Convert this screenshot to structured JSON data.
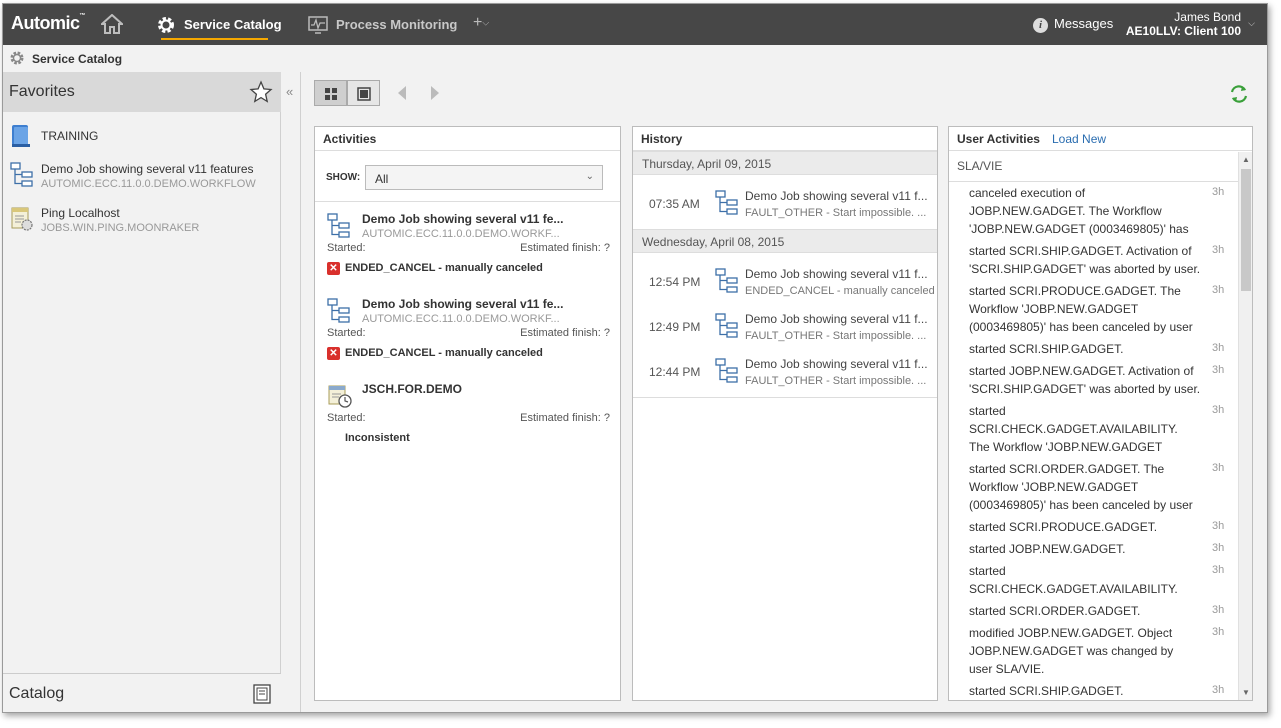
{
  "topbar": {
    "logo": "Automic",
    "tabs": [
      {
        "label": "Service Catalog",
        "active": true
      },
      {
        "label": "Process Monitoring",
        "active": false
      }
    ],
    "plus_label": "+",
    "messages_label": "Messages",
    "user_name": "James Bond",
    "user_client": "AE10LLV: Client 100",
    "accent_color": "#f5a800"
  },
  "breadcrumb": {
    "label": "Service Catalog"
  },
  "left": {
    "favorites_title": "Favorites",
    "favorites": [
      {
        "title": "TRAINING",
        "subtitle": "",
        "icon": "folder-icon"
      },
      {
        "title": "Demo Job showing several v11 features",
        "subtitle": "AUTOMIC.ECC.11.0.0.DEMO.WORKFLOW",
        "icon": "workflow-icon"
      },
      {
        "title": "Ping Localhost",
        "subtitle": "JOBS.WIN.PING.MOONRAKER",
        "icon": "job-icon"
      }
    ],
    "catalog_title": "Catalog"
  },
  "activities": {
    "title": "Activities",
    "show_label": "SHOW:",
    "show_value": "All",
    "items": [
      {
        "title": "Demo Job showing several v11 fe...",
        "subtitle": "AUTOMIC.ECC.11.0.0.DEMO.WORKF...",
        "started": "Started:",
        "estimated": "Estimated finish: ?",
        "status": "ENDED_CANCEL - manually canceled"
      },
      {
        "title": "Demo Job showing several v11 fe...",
        "subtitle": "AUTOMIC.ECC.11.0.0.DEMO.WORKF...",
        "started": "Started:",
        "estimated": "Estimated finish: ?",
        "status": "ENDED_CANCEL - manually canceled"
      },
      {
        "title": "JSCH.FOR.DEMO",
        "subtitle": "",
        "started": "Started:",
        "estimated": "Estimated finish: ?",
        "status": "Inconsistent"
      }
    ]
  },
  "history": {
    "title": "History",
    "days": [
      {
        "label": "Thursday, April 09, 2015",
        "rows": [
          {
            "time": "07:35 AM",
            "title": "Demo Job showing several v11 f...",
            "status": "FAULT_OTHER - Start impossible. ..."
          }
        ]
      },
      {
        "label": "Wednesday, April 08, 2015",
        "rows": [
          {
            "time": "12:54 PM",
            "title": "Demo Job showing several v11 f...",
            "status": "ENDED_CANCEL - manually canceled"
          },
          {
            "time": "12:49 PM",
            "title": "Demo Job showing several v11 f...",
            "status": "FAULT_OTHER - Start impossible. ..."
          },
          {
            "time": "12:44 PM",
            "title": "Demo Job showing several v11 f...",
            "status": "FAULT_OTHER - Start impossible. ..."
          }
        ]
      }
    ]
  },
  "user_activities": {
    "title": "User Activities",
    "load_new": "Load New",
    "user": "SLA/VIE",
    "items": [
      {
        "lines": [
          "canceled execution of",
          "JOBP.NEW.GADGET. The Workflow",
          "'JOBP.NEW.GADGET (0003469805)' has"
        ],
        "time": "3h"
      },
      {
        "lines": [
          "started SCRI.SHIP.GADGET. Activation of",
          "'SCRI.SHIP.GADGET' was aborted by user."
        ],
        "time": "3h"
      },
      {
        "lines": [
          "started SCRI.PRODUCE.GADGET. The",
          "Workflow 'JOBP.NEW.GADGET",
          "(0003469805)' has been canceled by user"
        ],
        "time": "3h"
      },
      {
        "lines": [
          "started SCRI.SHIP.GADGET."
        ],
        "time": "3h"
      },
      {
        "lines": [
          "started JOBP.NEW.GADGET. Activation of",
          "'SCRI.SHIP.GADGET' was aborted by user."
        ],
        "time": "3h"
      },
      {
        "lines": [
          "started",
          "SCRI.CHECK.GADGET.AVAILABILITY.",
          "The Workflow 'JOBP.NEW.GADGET"
        ],
        "time": "3h"
      },
      {
        "lines": [
          "started SCRI.ORDER.GADGET. The",
          "Workflow 'JOBP.NEW.GADGET",
          "(0003469805)' has been canceled by user"
        ],
        "time": "3h"
      },
      {
        "lines": [
          "started SCRI.PRODUCE.GADGET."
        ],
        "time": "3h"
      },
      {
        "lines": [
          "started JOBP.NEW.GADGET."
        ],
        "time": "3h"
      },
      {
        "lines": [
          "started",
          "SCRI.CHECK.GADGET.AVAILABILITY."
        ],
        "time": "3h"
      },
      {
        "lines": [
          "started SCRI.ORDER.GADGET."
        ],
        "time": "3h"
      },
      {
        "lines": [
          "modified JOBP.NEW.GADGET. Object",
          "JOBP.NEW.GADGET was changed by",
          "user SLA/VIE."
        ],
        "time": "3h"
      },
      {
        "lines": [
          "started SCRI.SHIP.GADGET."
        ],
        "time": "3h"
      }
    ]
  }
}
